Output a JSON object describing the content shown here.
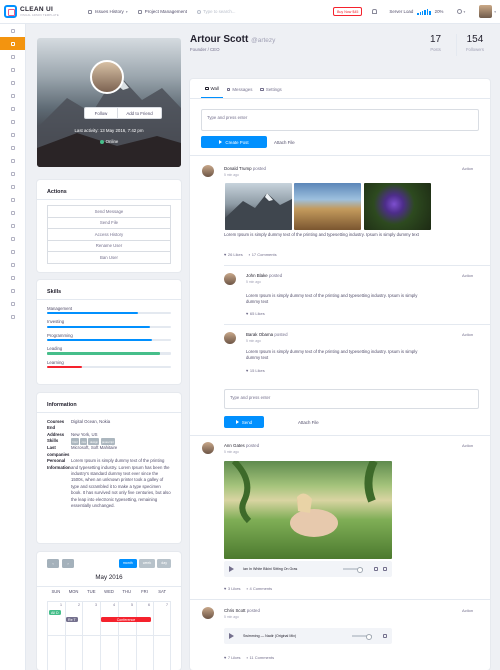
{
  "topbar": {
    "logo_title": "CLEAN UI",
    "logo_subtitle": "VISUAL ADMIN TEMPLATE",
    "issues_history": "Issues History",
    "project_management": "Project Management",
    "search_placeholder": "Type to search...",
    "buy_button": "Buy Now $45",
    "server_load_label": "Server Load",
    "server_load_value": "20%"
  },
  "profile": {
    "name": "Artour Scott",
    "handle": "@artezy",
    "role": "Founder / CEO",
    "posts_count": "17",
    "posts_label": "Posts",
    "followers_count": "154",
    "followers_label": "Followers",
    "follow_label": "Follow",
    "add_friend_label": "Add to Friend",
    "last_activity": "Last activity: 13 May 2016, 7:42 pm",
    "status": "Online"
  },
  "actions": {
    "title": "Actions",
    "items": [
      "Send Message",
      "Send File",
      "Access History",
      "Rename User",
      "Ban User"
    ]
  },
  "skills": {
    "title": "Skills",
    "items": [
      {
        "label": "Management",
        "value": 0.73,
        "color": "#0190fe"
      },
      {
        "label": "Investing",
        "value": 0.83,
        "color": "#0190fe"
      },
      {
        "label": "Programming",
        "value": 0.85,
        "color": "#0190fe"
      },
      {
        "label": "Leading",
        "value": 0.91,
        "color": "#46be8a"
      },
      {
        "label": "Learning",
        "value": 0.28,
        "color": "#f5222d"
      }
    ]
  },
  "information": {
    "title": "Information",
    "courses_label": "Courses End",
    "courses_value": "Digital Ocean, Nokia",
    "address_label": "Address",
    "address_value": "New York, US",
    "skills_label": "Skills",
    "skill_tags": [
      "html",
      "css",
      "design",
      "javascript"
    ],
    "last_companies_label": "Last companies",
    "last_companies_value": "Microsoft, Soft Mahitaire",
    "personal_label": "Personal Information",
    "personal_value": "Lorem Ipsum is simply dummy text of the printing and typesetting industry. Lorem Ipsum has been the industry's standard dummy text ever since the 1500s, when an unknown printer took a galley of type and scrambled it to make a type specimen book. It has survived not only five centuries, but also the leap into electronic typesetting, remaining essentially unchanged."
  },
  "calendar": {
    "prev": "‹",
    "next": "›",
    "views": [
      "month",
      "week",
      "day"
    ],
    "month_title": "May 2016",
    "weekdays": [
      "SUN",
      "MON",
      "TUE",
      "WED",
      "THU",
      "FRI",
      "SAT"
    ],
    "dates_row1": [
      "1",
      "2",
      "3",
      "4",
      "5",
      "6",
      "7"
    ],
    "events": [
      "All D",
      "Re T",
      "Conference"
    ]
  },
  "tabs": [
    {
      "label": "Wall",
      "icon": "wall-icon"
    },
    {
      "label": "Messages",
      "icon": "messages-icon"
    },
    {
      "label": "Settings",
      "icon": "settings-icon"
    }
  ],
  "composer": {
    "placeholder": "Type and press enter",
    "create_post": "Create Post",
    "attach_file": "Attach File"
  },
  "posts": [
    {
      "author": "Donald Trump",
      "verb": "posted",
      "time": "5 min ago",
      "action": "Action",
      "text": "Lorem Ipsum is simply dummy text of the printing and typesetting industry. Ipsum is simply dummy text",
      "likes": "26 Likes",
      "comments": "17 Comments"
    },
    {
      "author": "John Blake",
      "verb": "posted",
      "time": "5 min ago",
      "action": "Action",
      "text": "Lorem Ipsum is simply dummy text of the printing and typesetting industry. Ipsum is simply dummy text",
      "likes": "65 Likes"
    },
    {
      "author": "Barak Obama",
      "verb": "posted",
      "time": "5 min ago",
      "action": "Action",
      "text": "Lorem Ipsum is simply dummy text of the printing and typesetting industry. Ipsum is simply dummy text",
      "likes": "15 Likes"
    },
    {
      "author": "Ann Gates",
      "verb": "posted",
      "time": "5 min ago",
      "action": "Action",
      "track": "Ian In White Bikini Sitting On Gras",
      "likes": "3 Likes",
      "comments": "4 Comments"
    },
    {
      "author": "Chris Scott",
      "verb": "posted",
      "time": "5 min ago",
      "action": "Action",
      "track": "Swimming — Nadir (Original Mix)",
      "likes": "7 Likes",
      "comments": "11 Comments"
    }
  ],
  "reply": {
    "placeholder": "Type and press enter",
    "send": "Send",
    "attach_file": "Attach File"
  }
}
